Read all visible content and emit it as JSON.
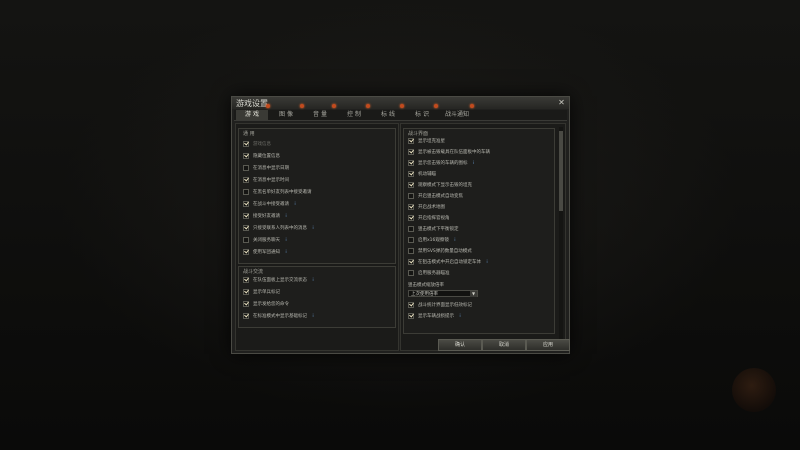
{
  "window": {
    "title": "游戏设置"
  },
  "tabs": [
    {
      "label": "游 戏",
      "active": true
    },
    {
      "label": "图 像",
      "active": false
    },
    {
      "label": "音 量",
      "active": false
    },
    {
      "label": "控 制",
      "active": false
    },
    {
      "label": "标 线",
      "active": false
    },
    {
      "label": "标 识",
      "active": false
    },
    {
      "label": "战斗通知",
      "active": false
    }
  ],
  "left": {
    "general": {
      "title": "通 用",
      "items": [
        {
          "label": "游戏信息",
          "checked": true,
          "disabled": true
        },
        {
          "label": "隐藏位置信息",
          "checked": true
        },
        {
          "label": "在消息中显示日期",
          "checked": false
        },
        {
          "label": "在消息中显示时间",
          "checked": true
        },
        {
          "label": "在黑名单好友列表中接受邀请",
          "checked": false
        },
        {
          "label": "在战斗中接受邀请",
          "checked": true
        },
        {
          "label": "接受好友邀请",
          "checked": true
        },
        {
          "label": "只接受联系人列表中的消息",
          "checked": true
        },
        {
          "label": "关闭服务聊天",
          "checked": false
        },
        {
          "label": "使用军团通知",
          "checked": true
        }
      ]
    },
    "battle_chat": {
      "title": "战斗交流",
      "items": [
        {
          "label": "在队伍面板上显示交流状态",
          "checked": true
        },
        {
          "label": "显示单兵标记",
          "checked": true
        },
        {
          "label": "显示发给您的命令",
          "checked": true
        },
        {
          "label": "在标准模式中显示基础标记",
          "checked": true
        }
      ]
    }
  },
  "right": {
    "battle_interface": {
      "title": "战斗界面",
      "items": [
        {
          "label": "显示坦克准星",
          "checked": true
        },
        {
          "label": "显示被击毁载具在队伍面板中的车辆",
          "checked": true
        },
        {
          "label": "显示您击毁的车辆的图标",
          "checked": true
        },
        {
          "label": "机动辅瞄",
          "checked": true
        },
        {
          "label": "观察模式下显示击毁的坦克",
          "checked": true
        },
        {
          "label": "开启狙击模式自动变焦",
          "checked": false
        },
        {
          "label": "开启战术地图",
          "checked": true
        },
        {
          "label": "开启指挥官视角",
          "checked": true
        },
        {
          "label": "狙击模式下平衡锁定",
          "checked": false
        },
        {
          "label": "启用x16观察镜",
          "checked": false
        },
        {
          "label": "禁用SVS弹药数量自动模式",
          "checked": false
        },
        {
          "label": "在狙击模式中开启自动锁定车体",
          "checked": true
        },
        {
          "label": "启用服务器瞄准",
          "checked": false
        }
      ],
      "select_label": "狙击模式缩放倍率",
      "select_value": "上次使用倍率",
      "extra_items": [
        {
          "label": "战斗统计界面显示低效标记",
          "checked": true
        },
        {
          "label": "显示车辆战损提示",
          "checked": true
        }
      ]
    }
  },
  "footer": {
    "ok": "确认",
    "cancel": "取消",
    "apply": "应用"
  },
  "icons": {
    "close": "close-icon",
    "info": "info-icon",
    "dropdown": "chevron-down-icon"
  },
  "colors": {
    "accent_dot": "#c24b1e",
    "info": "#6aa0d8"
  }
}
